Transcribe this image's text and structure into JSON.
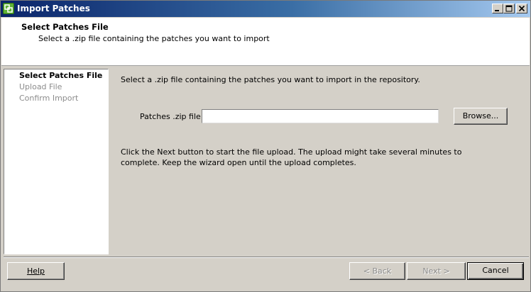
{
  "window": {
    "title": "Import Patches",
    "controls": {
      "minimize": "_",
      "maximize": "□",
      "close": "X"
    }
  },
  "header": {
    "title": "Select Patches File",
    "subtitle": "Select a .zip file containing the patches you want to import"
  },
  "nav": {
    "items": [
      {
        "label": "Select Patches File",
        "state": "active"
      },
      {
        "label": "Upload File",
        "state": "disabled"
      },
      {
        "label": "Confirm Import",
        "state": "disabled"
      }
    ]
  },
  "main": {
    "intro": "Select a .zip file containing the patches you want to import in the repository.",
    "field_label": "Patches .zip file:",
    "file_value": "",
    "browse_label": "Browse...",
    "info": "Click the Next button to start the file upload. The upload might take several minutes to complete. Keep the wizard open until the upload completes."
  },
  "footer": {
    "help_label": "Help",
    "back_label": "< Back",
    "next_label": "Next >",
    "cancel_label": "Cancel"
  },
  "icons": {
    "app": "vmware-app-icon",
    "minimize": "minimize-icon",
    "maximize": "maximize-icon",
    "close": "close-icon"
  },
  "colors": {
    "titlebar_start": "#0a246a",
    "titlebar_end": "#a6caf0",
    "dialog_bg": "#d4d0c8",
    "disabled_text": "#8c8c8c"
  }
}
